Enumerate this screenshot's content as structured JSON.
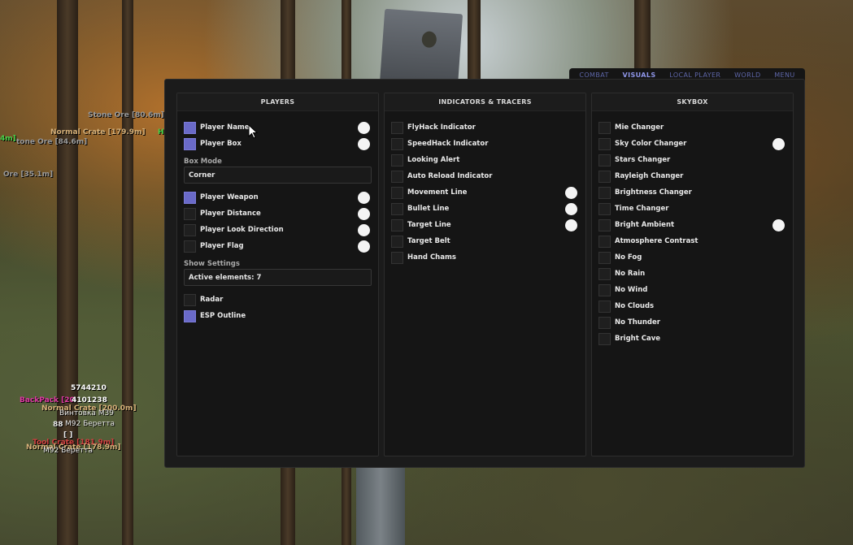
{
  "colors": {
    "accent": "#6a6ac8",
    "tab_active": "#8f96e8",
    "tab_inactive": "#5e66a8",
    "swatch": "#f4f4f4"
  },
  "tabs": [
    {
      "label": "COMBAT",
      "active": false
    },
    {
      "label": "VISUALS",
      "active": true
    },
    {
      "label": "LOCAL PLAYER",
      "active": false
    },
    {
      "label": "WORLD",
      "active": false
    },
    {
      "label": "MENU",
      "active": false
    }
  ],
  "players": {
    "title": "PLAYERS",
    "player_name": {
      "label": "Player Name",
      "checked": true
    },
    "player_box": {
      "label": "Player Box",
      "checked": true
    },
    "box_mode_label": "Box Mode",
    "box_mode_value": "Corner",
    "player_weapon": {
      "label": "Player Weapon",
      "checked": true
    },
    "player_distance": {
      "label": "Player Distance",
      "checked": false
    },
    "player_look_direction": {
      "label": "Player Look Direction",
      "checked": false
    },
    "player_flag": {
      "label": "Player Flag",
      "checked": false
    },
    "show_settings_label": "Show Settings",
    "show_settings_value": "Active elements: 7",
    "radar": {
      "label": "Radar",
      "checked": false
    },
    "esp_outline": {
      "label": "ESP Outline",
      "checked": true
    }
  },
  "indicators": {
    "title": "INDICATORS & TRACERS",
    "items": [
      {
        "label": "FlyHack Indicator",
        "checked": false,
        "color": false
      },
      {
        "label": "SpeedHack Indicator",
        "checked": false,
        "color": false
      },
      {
        "label": "Looking Alert",
        "checked": false,
        "color": false
      },
      {
        "label": "Auto Reload Indicator",
        "checked": false,
        "color": false
      },
      {
        "label": "Movement Line",
        "checked": false,
        "color": true
      },
      {
        "label": "Bullet Line",
        "checked": false,
        "color": true
      },
      {
        "label": "Target Line",
        "checked": false,
        "color": true
      },
      {
        "label": "Target Belt",
        "checked": false,
        "color": false
      },
      {
        "label": "Hand Chams",
        "checked": false,
        "color": false
      }
    ]
  },
  "skybox": {
    "title": "SKYBOX",
    "items": [
      {
        "label": "Mie Changer",
        "checked": false,
        "color": false
      },
      {
        "label": "Sky Color Changer",
        "checked": false,
        "color": true
      },
      {
        "label": "Stars Changer",
        "checked": false,
        "color": false
      },
      {
        "label": "Rayleigh Changer",
        "checked": false,
        "color": false
      },
      {
        "label": "Brightness Changer",
        "checked": false,
        "color": false
      },
      {
        "label": "Time Changer",
        "checked": false,
        "color": false
      },
      {
        "label": "Bright Ambient",
        "checked": false,
        "color": true
      },
      {
        "label": "Atmosphere Contrast",
        "checked": false,
        "color": false
      },
      {
        "label": "No Fog",
        "checked": false,
        "color": false
      },
      {
        "label": "No Rain",
        "checked": false,
        "color": false
      },
      {
        "label": "No Wind",
        "checked": false,
        "color": false
      },
      {
        "label": "No Clouds",
        "checked": false,
        "color": false
      },
      {
        "label": "No Thunder",
        "checked": false,
        "color": false
      },
      {
        "label": "Bright Cave",
        "checked": false,
        "color": false
      }
    ]
  },
  "esp_labels": {
    "stone_ore_1": "Stone Ore [80.6m]",
    "normal_crate_1": "Normal Crate [179.9m]",
    "green_tag_1": "4m]",
    "green_tag_2": "H",
    "stone_ore_2": "tone Ore [84.6m]",
    "ore_3": "Ore [35.1m]",
    "id_1": "5744210",
    "backpack": "BackPack [20",
    "id_2": "4101238",
    "normal_crate_2": "Normal Crate [200.0m]",
    "rifle": "Винтовка M39",
    "num_88": "88",
    "m92_1": "M92 Беретта",
    "bracket": "[ ]",
    "tool_crate": "Tool Crate [181.9m]",
    "normal_crate_3": "Normal Crate [178.9m]",
    "m92_2": "M92 Беретта"
  }
}
